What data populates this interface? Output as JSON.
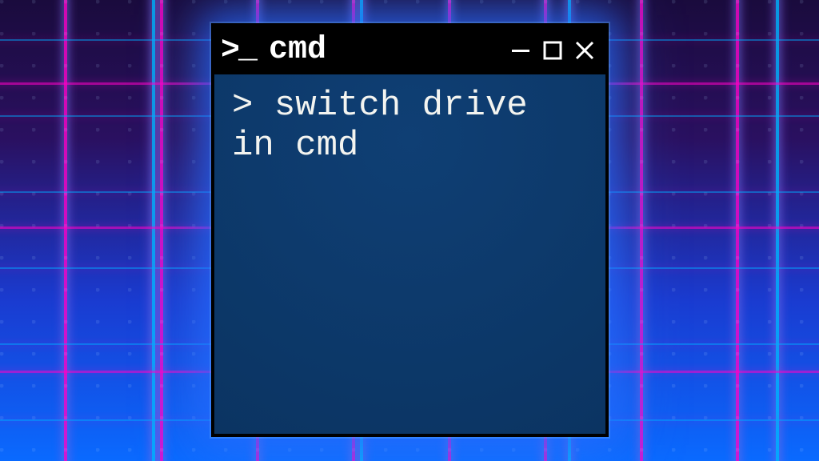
{
  "window": {
    "title": "cmd",
    "prompt_icon": {
      "gt": ">",
      "underscore": "_"
    }
  },
  "terminal": {
    "prompt": ">",
    "command": "switch drive in cmd"
  }
}
